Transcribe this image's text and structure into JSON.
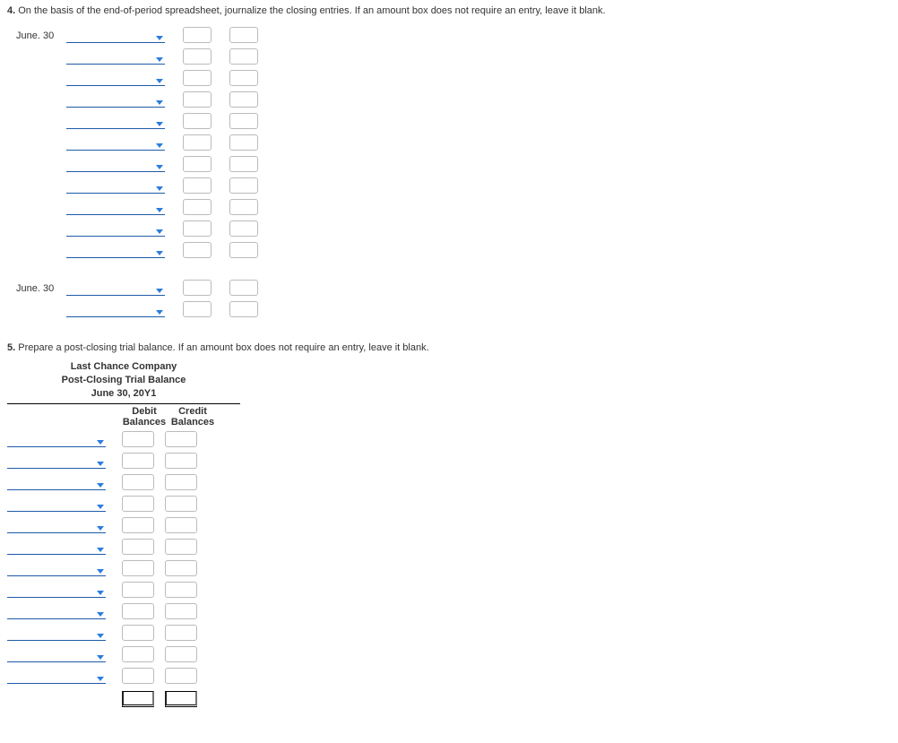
{
  "q4": {
    "number": "4.",
    "text": "On the basis of the end-of-period spreadsheet, journalize the closing entries. If an amount box does not require an entry, leave it blank.",
    "date1": "June. 30",
    "date2": "June. 30",
    "group1_rows": 11,
    "group2_rows": 2
  },
  "q5": {
    "number": "5.",
    "text": "Prepare a post-closing trial balance. If an amount box does not require an entry, leave it blank.",
    "company": "Last Chance Company",
    "statement": "Post-Closing Trial Balance",
    "date": "June 30, 20Y1",
    "col1_line1": "Debit",
    "col1_line2": "Balances",
    "col2_line1": "Credit",
    "col2_line2": "Balances",
    "rows": 12
  }
}
